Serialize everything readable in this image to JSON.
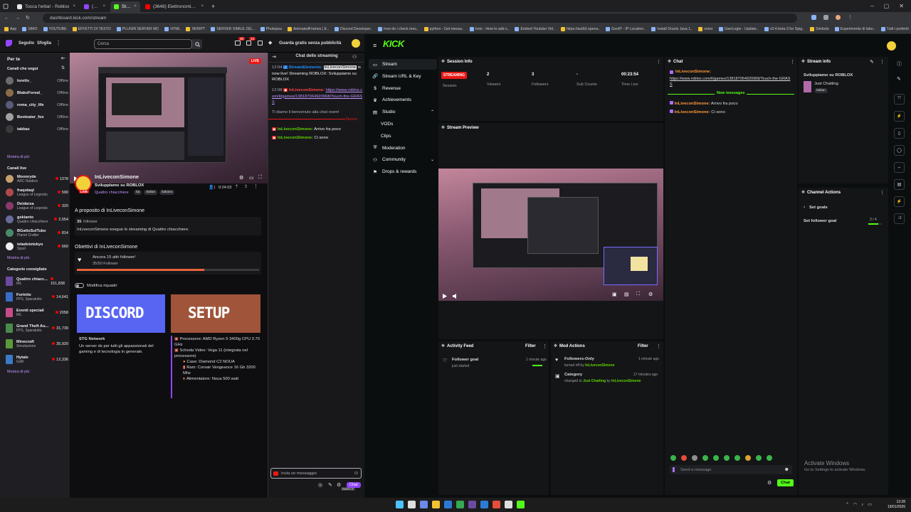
{
  "browser": {
    "tabs": [
      {
        "label": "Tocca l'erba! - Roblox",
        "color": "#e8e8e8"
      },
      {
        "label": "(12) InLiv",
        "color": "#9146ff"
      },
      {
        "label": "Stream",
        "color": "#53fc18"
      },
      {
        "label": "(3648) Elettronomia & 3D - Fra",
        "color": "#ff0000"
      }
    ],
    "url": "dashboard.kick.com/stream",
    "bookmarks": [
      "App",
      "SIMO",
      "YOUTUBE",
      "EFFETTI DI TESTO",
      "PLUGIN SERVER MC",
      "HTML",
      "SKRIPT",
      "SERVER SIMILE ZEL..",
      "Photopea",
      "AnimatedFrames | E..",
      "Discord Developer..",
      "how do i check mes..",
      "python - Get messa..",
      "bots - How to add s..",
      "Embed Youtube Vid..",
      "https://auth0.opena..",
      "GeoIP - IP Location..",
      "Install Oracle Java 1..",
      "ocker",
      "UserLogin - Update..",
      "v3.4-beta-3 for Spig..",
      "Simbolo",
      "Esperimento di labo..",
      "Tutti i preferiti"
    ]
  },
  "twitch": {
    "nav": {
      "following": "Seguito",
      "browse": "Sfoglia",
      "search_placeholder": "Cerca",
      "badge1": "30",
      "badge2": "13",
      "promo": "Guarda gratis senza pubblicità"
    },
    "sidebar": {
      "for_you": "Per te",
      "followed_title": "Canali che segui",
      "followed": [
        {
          "name": "lorettv_",
          "status": "Offline",
          "color": "#6b6b6b"
        },
        {
          "name": "BlakoForeal_",
          "status": "Offline",
          "color": "#8a6b4a"
        },
        {
          "name": "roma_city_life",
          "status": "Offline",
          "color": "#5a5a7a"
        },
        {
          "name": "Booteater_fox",
          "status": "Offline",
          "color": "#a0a0a0"
        },
        {
          "name": "tabbaz",
          "status": "Offline",
          "color": "#3a3a3a"
        }
      ],
      "show_more": "Mostra di più",
      "live_title": "Canali live",
      "live": [
        {
          "name": "Moonryde",
          "game": "ARC Raiders",
          "viewers": "1378",
          "color": "#c7a06b"
        },
        {
          "name": "fraqolaqt",
          "game": "League of Legends",
          "viewers": "590",
          "color": "#b04a4a"
        },
        {
          "name": "Deidarsa",
          "game": "League of Legends",
          "viewers": "320",
          "color": "#8a3a6b"
        },
        {
          "name": "gskianto",
          "game": "Quattro chiacchiere",
          "viewers": "2,554",
          "color": "#6b6b9a"
        },
        {
          "name": "BGattoSulTubo",
          "game": "Planet Crafter",
          "viewers": "814",
          "color": "#4a8a6b"
        },
        {
          "name": "teladoiotokyo",
          "game": "Sport",
          "viewers": "660",
          "color": "#eeeeee"
        }
      ],
      "rec_title": "Categorie consigliate",
      "categories": [
        {
          "name": "Quattro chiacc...",
          "sub": "IRL",
          "viewers": "151,838",
          "color": "#6b4aa0"
        },
        {
          "name": "Fortnite",
          "sub": "FPS, Sparatutto",
          "viewers": "14,641",
          "color": "#3a6bc7"
        },
        {
          "name": "Eventi speciali",
          "sub": "IRL",
          "viewers": "2058",
          "color": "#c74a8a"
        },
        {
          "name": "Grand Theft Au...",
          "sub": "FPS, Sparatutto",
          "viewers": "31,739",
          "color": "#4a8a4a"
        },
        {
          "name": "Minecraft",
          "sub": "Simulazione",
          "viewers": "35,920",
          "color": "#5a9a3a"
        },
        {
          "name": "Hytale",
          "sub": "GdR",
          "viewers": "12,336",
          "color": "#3a7ac7"
        }
      ]
    },
    "channel": {
      "name": "InLiveconSimone",
      "title": "Sviluppiamo su ROBLOX",
      "category": "Quattro chiacchiere",
      "tags": [
        "Ita",
        "Italian",
        "italiano"
      ],
      "viewers": "1",
      "uptime": "0:24:03",
      "live_label": "LIVE",
      "about_title": "A proposito di InLiveconSimone",
      "followers_count": "35",
      "followers_label": "follower",
      "about_text": "InLiveconSimone esegue lo streaming di Quattro chiacchiere.",
      "goals_title": "Obiettivi di InLiveconSimone",
      "goal_text": "Ancora 15 altri follower!",
      "goal_progress": "35/50 Follower",
      "goal_fraction": 0.7,
      "edit_panels": "Modifica riquadri",
      "panels": [
        {
          "image_text": "DISCORD",
          "title": "STG Network",
          "body": "Un server ds per tutti gli appassionati del gaming e di tecnologia in generale."
        },
        {
          "image_text": "SETUP",
          "specs": [
            "Processore: AMD Ryzen 5 3400g CPU 3.70 GHz",
            "Scheda Video: Vega 11 (integrata nel processore)",
            "Case: Diamond C2 NOUA",
            "Ram: Corsair Vengeance 16 Gb 3200 Mhz",
            "Alimentatore: Noua 500 watt"
          ]
        }
      ]
    },
    "chat": {
      "title": "Chat dello streaming",
      "messages": [
        {
          "time": "12:04",
          "user": "StreamElements:",
          "highlight": "InLiveconSimone",
          "text": "is now live! Streaming ROBLOX: Sviluppiamo su ROBLOX"
        },
        {
          "time": "12:08",
          "user": "InLiveconSimone:",
          "text": "https://www.roblox.com/it/games/138187064920968/Touch-the-GRASS"
        },
        {
          "text": "Ti diamo il benvenuto alla chat room!"
        }
      ],
      "new_label": "Nuovo",
      "new_messages": [
        {
          "user": "InLiveconSimone:",
          "text": "Arrivo fra poco"
        },
        {
          "user": "InLiveconSimone:",
          "text": "Ci sono"
        }
      ],
      "input_placeholder": "Invia un messaggio",
      "send": "Chat",
      "bits": "twitch.tv"
    }
  },
  "kick": {
    "logo": "KICK",
    "nav": [
      "Stream",
      "Stream URL & Key",
      "Revenue",
      "Achievements",
      "Studio",
      "VODs",
      "Clips",
      "Moderation",
      "Community",
      "Drops & rewards"
    ],
    "session": {
      "title": "Session Info",
      "status": "STREAMING",
      "status_label": "Session",
      "stats": [
        {
          "value": "2",
          "label": "Viewers"
        },
        {
          "value": "3",
          "label": "Followers"
        },
        {
          "value": "-",
          "label": "Sub Counts"
        },
        {
          "value": "00:23:54",
          "label": "Time Live"
        }
      ]
    },
    "preview_title": "Stream Preview",
    "chat": {
      "title": "Chat",
      "first_user": "InLiveconSimone:",
      "first_link": "https://www.roblox.com/it/games/138187064920968/Touch-the-GRASS",
      "new_messages": "New messages",
      "messages": [
        {
          "user": "InLiveconSimone:",
          "text": "Arrivo fra poco"
        },
        {
          "user": "InLiveconSimone:",
          "text": "Ci sono"
        }
      ],
      "input_placeholder": "Send a message",
      "send": "Chat"
    },
    "stream_info": {
      "title": "Stream info",
      "stream_title": "Sviluppiamo su ROBLOX",
      "category": "Just Chatting",
      "language": "Italian"
    },
    "channel_actions": {
      "title": "Channel Actions",
      "back": "Set goals",
      "goal": "Set follower goal",
      "goal_count": "3 / 4",
      "goal_fraction": 0.75
    },
    "activity": {
      "title": "Activity Feed",
      "filter": "Filter",
      "item_title": "Follower goal",
      "item_sub": "just started",
      "item_time": "1 minute ago"
    },
    "mod": {
      "title": "Mod Actions",
      "filter": "Filter",
      "items": [
        {
          "title": "Followers-Only",
          "pre": "turned off by",
          "user": "InLiveconSimone",
          "time": "1 minute ago"
        },
        {
          "title": "Category",
          "pre": "changed to",
          "value": "Just Chatting",
          "mid": "by",
          "user": "InLiveconSimone",
          "time": "17 minutes ago"
        }
      ]
    },
    "windows": {
      "title": "Activate Windows",
      "sub": "Go to Settings to activate Windows."
    }
  },
  "taskbar": {
    "time": "12:28",
    "date": "19/01/2026"
  }
}
